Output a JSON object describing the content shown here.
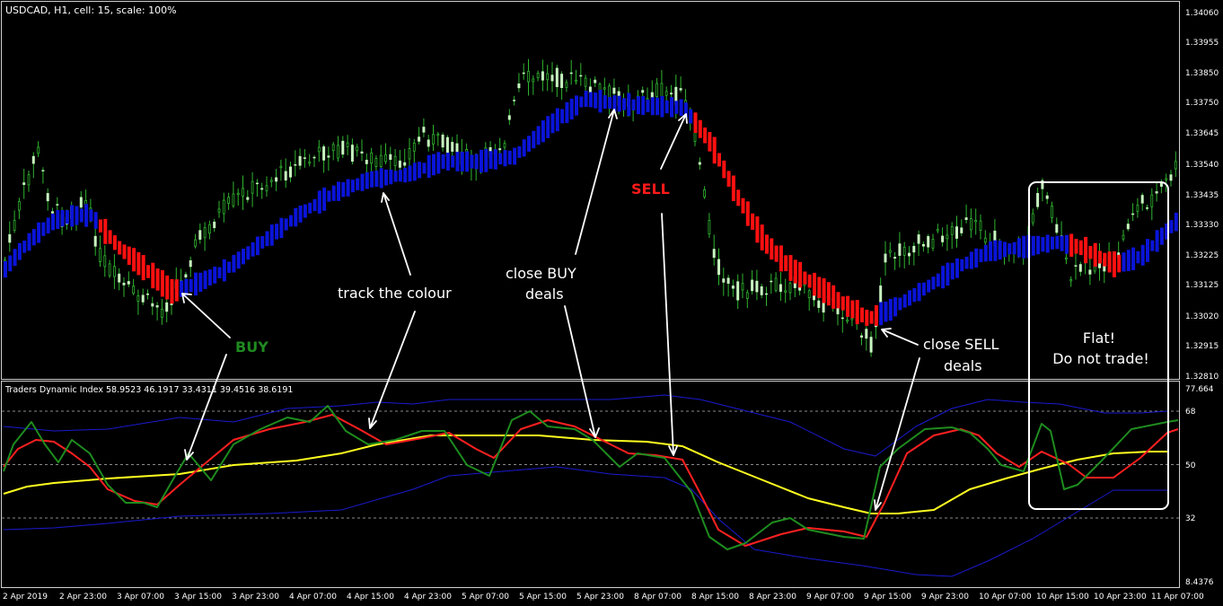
{
  "main_panel": {
    "header": "USDCAD, H1, cell: 15, scale: 100%",
    "price_axis": [
      "1.34060",
      "1.33955",
      "1.33850",
      "1.33750",
      "1.33645",
      "1.33540",
      "1.33435",
      "1.33330",
      "1.33225",
      "1.33125",
      "1.33020",
      "1.32915",
      "1.32810"
    ]
  },
  "indicator_panel": {
    "header": "Traders Dynamic Index 58.9523 46.1917 33.4311 39.4516 38.6191",
    "levels": [
      "77.664",
      "68",
      "50",
      "32",
      "8.4376"
    ]
  },
  "time_axis": [
    "2 Apr 2019",
    "2 Apr 23:00",
    "3 Apr 07:00",
    "3 Apr 15:00",
    "3 Apr 23:00",
    "4 Apr 07:00",
    "4 Apr 15:00",
    "4 Apr 23:00",
    "5 Apr 07:00",
    "5 Apr 15:00",
    "5 Apr 23:00",
    "8 Apr 07:00",
    "8 Apr 15:00",
    "8 Apr 23:00",
    "9 Apr 07:00",
    "9 Apr 15:00",
    "9 Apr 23:00",
    "10 Apr 07:00",
    "10 Apr 15:00",
    "10 Apr 23:00",
    "11 Apr 07:00"
  ],
  "annotations": {
    "buy": "BUY",
    "track": "track the colour",
    "close_buy_1": "close BUY",
    "close_buy_2": "deals",
    "sell": "SELL",
    "close_sell_1": "close SELL",
    "close_sell_2": "deals",
    "flat_1": "Flat!",
    "flat_2": "Do not trade!"
  },
  "colors": {
    "bull_candle": "#c8f5c0",
    "wick": "#2fb52f",
    "bull_mark": "#0a14d8",
    "bear_mark": "#ff1010",
    "rsi_line": "#1e8c1e",
    "signal_line": "#ff2020",
    "base_line": "#ffff20",
    "bands": "#1a1ad0",
    "buy_text": "#1f8a1f",
    "sell_text": "#ff1a1a"
  }
}
